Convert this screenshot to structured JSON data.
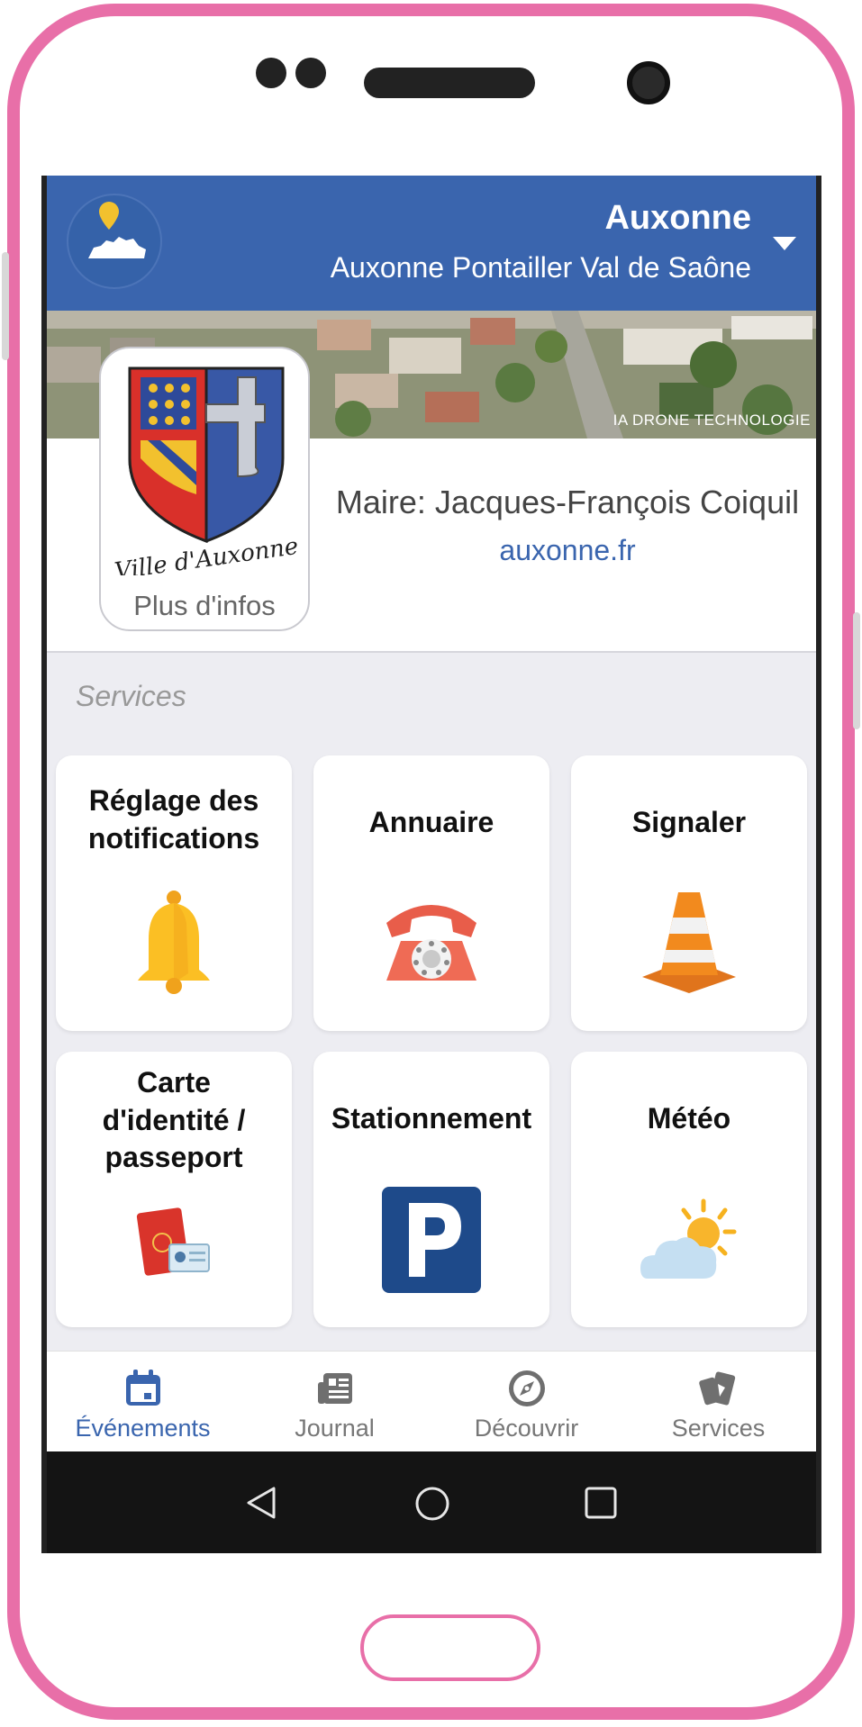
{
  "header": {
    "city": "Auxonne",
    "community": "Auxonne Pontailler Val de Saône"
  },
  "banner": {
    "credit": "IA DRONE TECHNOLOGIE"
  },
  "profile": {
    "more_info": "Plus d'infos",
    "mayor": "Maire: Jacques-François Coiquil",
    "website": "auxonne.fr"
  },
  "services": {
    "title": "Services",
    "tiles": [
      {
        "label": "Réglage des notifications",
        "icon": "bell-icon"
      },
      {
        "label": "Annuaire",
        "icon": "telephone-icon"
      },
      {
        "label": "Signaler",
        "icon": "traffic-cone-icon"
      },
      {
        "label": "Carte d'identité / passeport",
        "icon": "passport-icon"
      },
      {
        "label": "Stationnement",
        "icon": "parking-icon"
      },
      {
        "label": "Météo",
        "icon": "weather-icon"
      }
    ]
  },
  "tabs": [
    {
      "label": "Événements",
      "icon": "calendar-icon",
      "active": true
    },
    {
      "label": "Journal",
      "icon": "newspaper-icon",
      "active": false
    },
    {
      "label": "Découvrir",
      "icon": "compass-icon",
      "active": false
    },
    {
      "label": "Services",
      "icon": "cards-icon",
      "active": false
    }
  ],
  "colors": {
    "header": "#3a65ae",
    "frame": "#e86fa8",
    "active_tab": "#3a65ae"
  }
}
